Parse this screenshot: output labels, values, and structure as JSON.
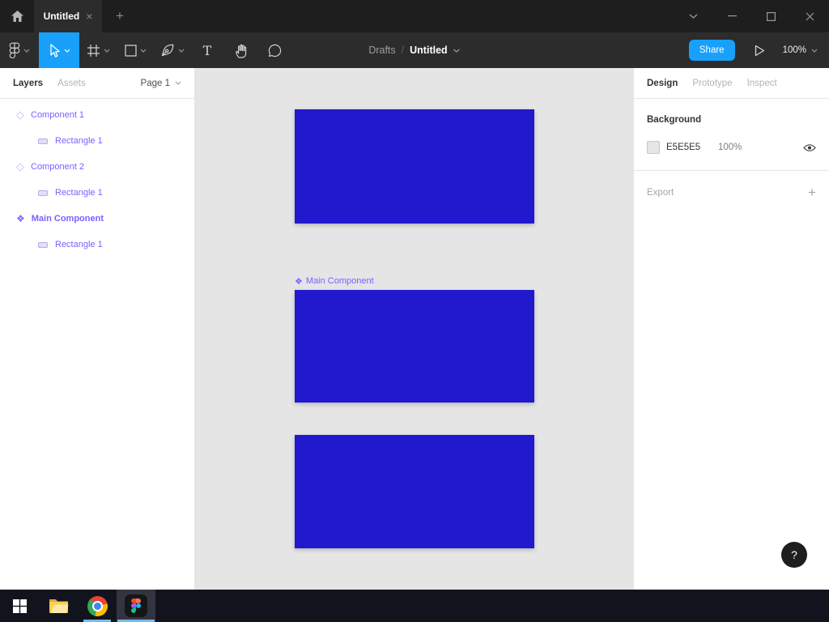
{
  "colors": {
    "accent_blue": "#18A0FB",
    "component_purple": "#7B61FF",
    "rect_blue": "#2119CE",
    "canvas_bg": "#E5E5E5"
  },
  "icons": {
    "component": "◇",
    "main_component": "❖",
    "close_tab": "×",
    "plus": "+",
    "help": "?"
  },
  "titlebar": {
    "tab_title": "Untitled"
  },
  "toolbar": {
    "breadcrumb_folder": "Drafts",
    "breadcrumb_sep": "/",
    "breadcrumb_file": "Untitled",
    "share": "Share",
    "zoom": "100%"
  },
  "left_panel": {
    "tab_layers": "Layers",
    "tab_assets": "Assets",
    "page": "Page 1",
    "layers": [
      {
        "name": "Component 1"
      },
      {
        "name": "Rectangle 1"
      },
      {
        "name": "Component 2"
      },
      {
        "name": "Rectangle 1"
      },
      {
        "name": "Main Component"
      },
      {
        "name": "Rectangle 1"
      }
    ]
  },
  "canvas": {
    "label_text": "Main Component"
  },
  "right_panel": {
    "tab_design": "Design",
    "tab_prototype": "Prototype",
    "tab_inspect": "Inspect",
    "background_title": "Background",
    "background_hex": "E5E5E5",
    "background_opacity": "100%",
    "export_title": "Export"
  }
}
